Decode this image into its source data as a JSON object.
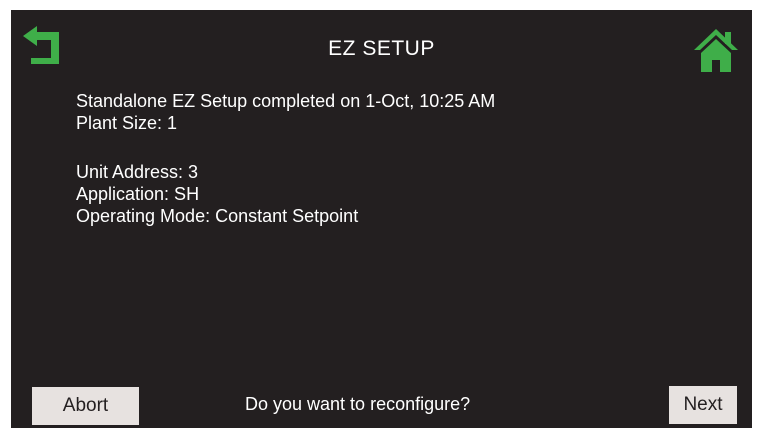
{
  "header": {
    "title": "EZ SETUP",
    "back_icon": "back-arrow-icon",
    "home_icon": "home-icon",
    "accent_color": "#3fae49"
  },
  "status": {
    "completed_text": "Standalone EZ Setup completed",
    "completed_on": "on 1-Oct, 10:25 AM",
    "plant_size": "Plant Size: 1"
  },
  "unit": {
    "address": "Unit Address: 3",
    "application": "Application: SH",
    "operating_mode_label": "Operating Mode:",
    "operating_mode_value": "Constant Setpoint"
  },
  "footer": {
    "abort_label": "Abort",
    "prompt": "Do you want to reconfigure?",
    "next_label": "Next"
  }
}
